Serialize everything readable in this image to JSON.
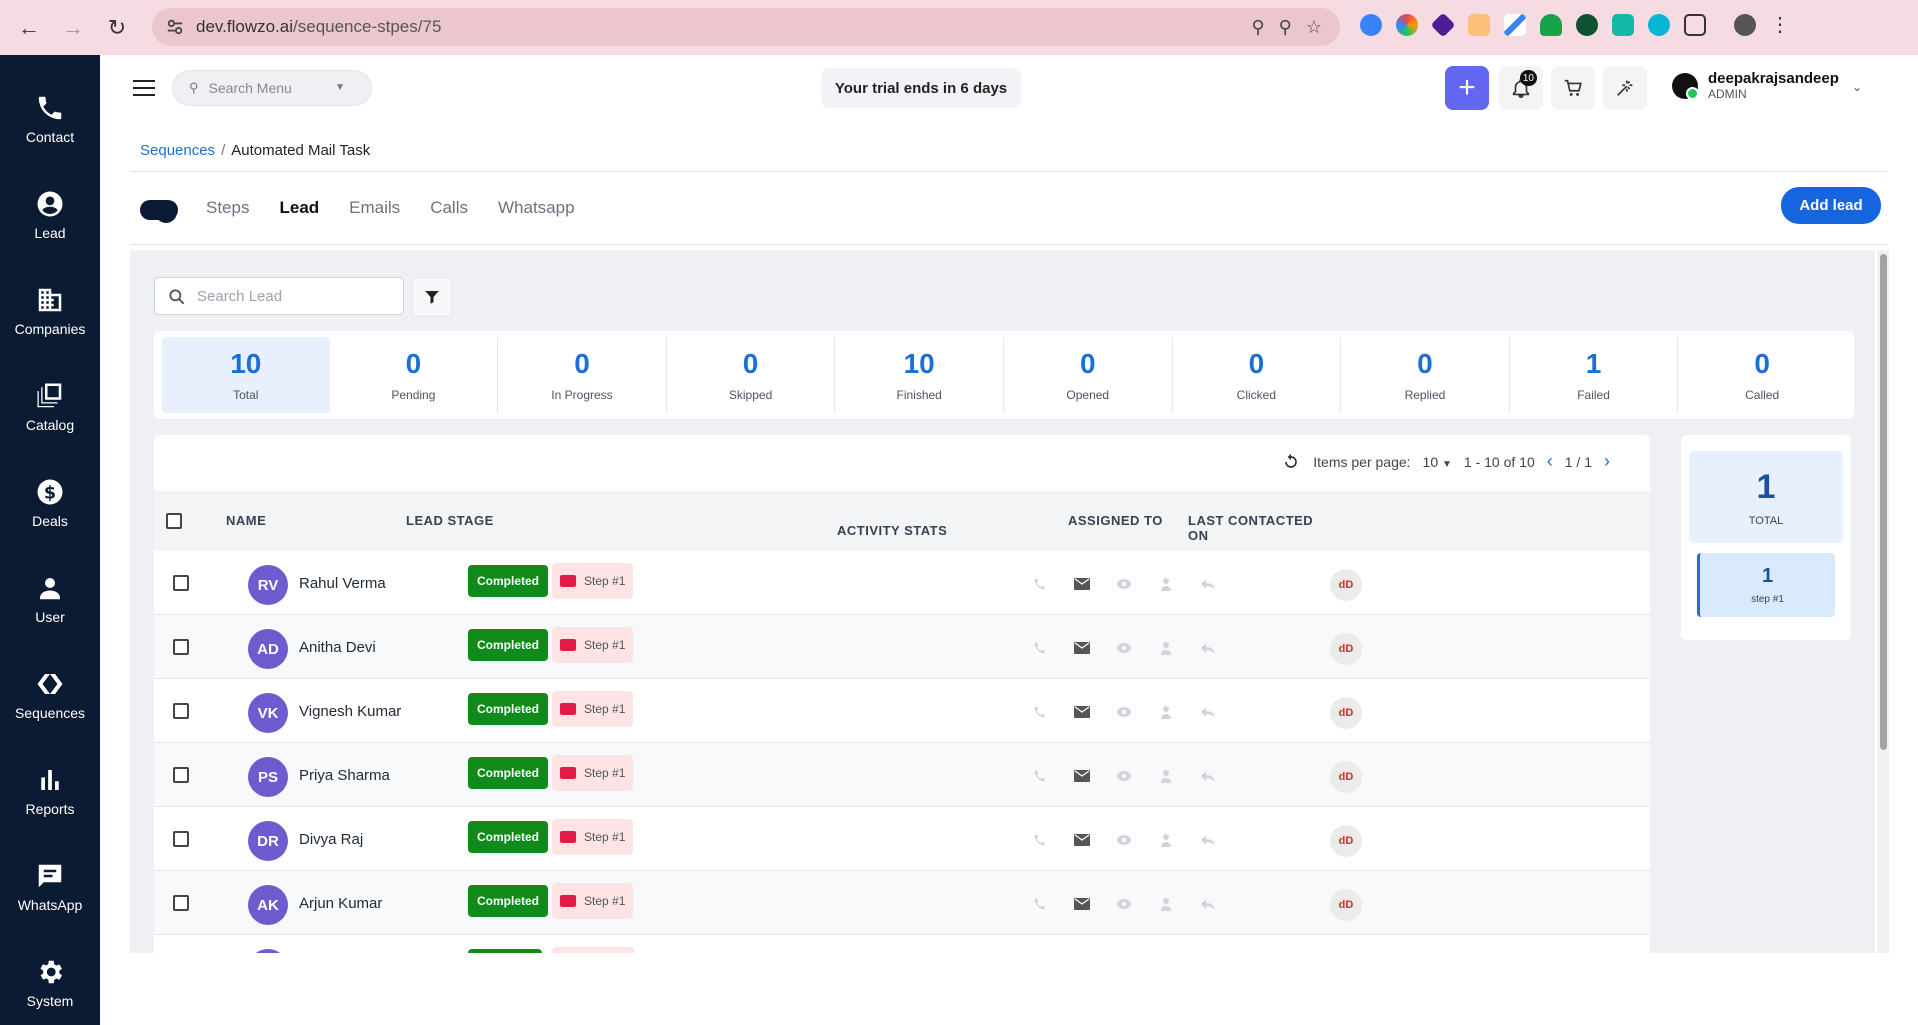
{
  "browser": {
    "url_host": "dev.flowzo.ai",
    "url_path": "/sequence-stpes/75"
  },
  "sidebar": {
    "items": [
      {
        "label": "Contact",
        "icon": "phone-icon"
      },
      {
        "label": "Lead",
        "icon": "account-circle-icon"
      },
      {
        "label": "Companies",
        "icon": "building-icon"
      },
      {
        "label": "Catalog",
        "icon": "catalog-icon"
      },
      {
        "label": "Deals",
        "icon": "dollar-icon"
      },
      {
        "label": "User",
        "icon": "person-icon"
      },
      {
        "label": "Sequences",
        "icon": "sequence-icon"
      },
      {
        "label": "Reports",
        "icon": "bar-chart-icon"
      },
      {
        "label": "WhatsApp",
        "icon": "chat-icon"
      },
      {
        "label": "System",
        "icon": "gear-icon"
      }
    ]
  },
  "header": {
    "search_placeholder": "Search Menu",
    "trial_text": "Your trial ends in 6 days",
    "notification_count": "10",
    "user_name": "deepakrajsandeep",
    "user_role": "ADMIN"
  },
  "breadcrumb": {
    "parent": "Sequences",
    "separator": "/",
    "current": "Automated Mail Task"
  },
  "tabs": [
    "Steps",
    "Lead",
    "Emails",
    "Calls",
    "Whatsapp"
  ],
  "active_tab": "Lead",
  "add_lead_label": "Add lead",
  "search_lead_placeholder": "Search Lead",
  "stats": [
    {
      "value": "10",
      "label": "Total"
    },
    {
      "value": "0",
      "label": "Pending"
    },
    {
      "value": "0",
      "label": "In Progress"
    },
    {
      "value": "0",
      "label": "Skipped"
    },
    {
      "value": "10",
      "label": "Finished"
    },
    {
      "value": "0",
      "label": "Opened"
    },
    {
      "value": "0",
      "label": "Clicked"
    },
    {
      "value": "0",
      "label": "Replied"
    },
    {
      "value": "1",
      "label": "Failed"
    },
    {
      "value": "0",
      "label": "Called"
    }
  ],
  "pager": {
    "items_per_page_label": "Items per page:",
    "items_per_page": "10",
    "range": "1 - 10 of 10",
    "page": "1 / 1"
  },
  "table": {
    "headers": {
      "name": "NAME",
      "lead_stage": "LEAD STAGE",
      "activity_stats": "ACTIVITY STATS",
      "assigned_to": "ASSIGNED TO",
      "last_contacted_l1": "LAST CONTACTED",
      "last_contacted_l2": "ON"
    },
    "rows": [
      {
        "initials": "RV",
        "name": "Rahul Verma",
        "stage": "Completed",
        "step": "Step #1",
        "assignee": "dD"
      },
      {
        "initials": "AD",
        "name": "Anitha Devi",
        "stage": "Completed",
        "step": "Step #1",
        "assignee": "dD"
      },
      {
        "initials": "VK",
        "name": "Vignesh Kumar",
        "stage": "Completed",
        "step": "Step #1",
        "assignee": "dD"
      },
      {
        "initials": "PS",
        "name": "Priya Sharma",
        "stage": "Completed",
        "step": "Step #1",
        "assignee": "dD"
      },
      {
        "initials": "DR",
        "name": "Divya Raj",
        "stage": "Completed",
        "step": "Step #1",
        "assignee": "dD"
      },
      {
        "initials": "AK",
        "name": "Arjun Kumar",
        "stage": "Completed",
        "step": "Step #1",
        "assignee": "dD"
      }
    ]
  },
  "summary": {
    "total_value": "1",
    "total_label": "TOTAL",
    "step_value": "1",
    "step_label": "step #1"
  },
  "colors": {
    "sidebar_bg": "#0b1b33",
    "primary": "#1565e0",
    "accent_purple": "#6366f1",
    "completed_green": "#118a1c"
  }
}
